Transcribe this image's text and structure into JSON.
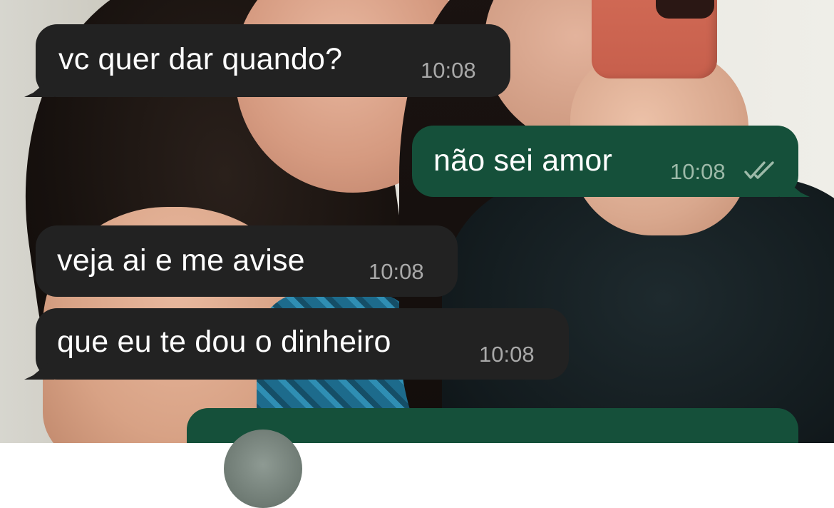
{
  "chat": {
    "messages": [
      {
        "direction": "incoming",
        "text": "vc quer dar quando?",
        "time": "10:08"
      },
      {
        "direction": "outgoing",
        "text": "não sei amor",
        "time": "10:08",
        "status": "read",
        "status_icon": "double-check-icon"
      },
      {
        "direction": "incoming",
        "text": "veja ai e me avise",
        "time": "10:08"
      },
      {
        "direction": "incoming",
        "text": "que eu te dou o dinheiro",
        "time": "10:08"
      },
      {
        "direction": "outgoing",
        "text": "",
        "partially_visible": true,
        "content": "avatar-peek"
      }
    ]
  },
  "colors": {
    "incoming_bubble": "#222222",
    "outgoing_bubble": "#15503a",
    "text": "#ffffff",
    "time_incoming": "#a9a9a9",
    "time_outgoing": "#9dbaa9"
  },
  "wallpaper": {
    "type": "photo"
  }
}
